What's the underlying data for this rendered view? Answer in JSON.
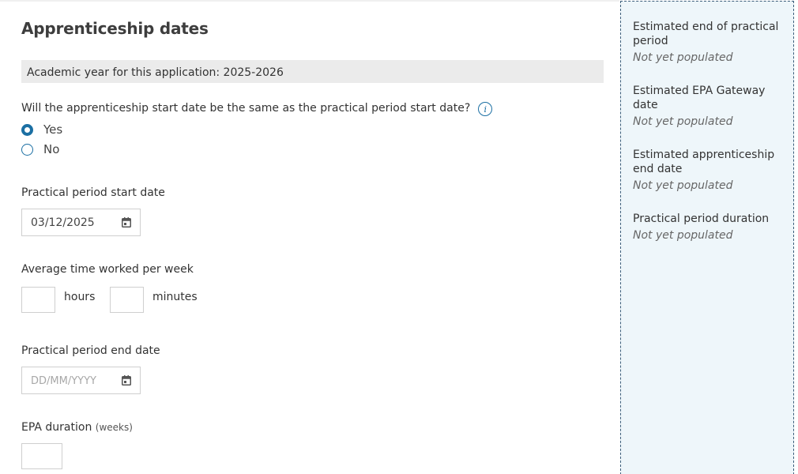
{
  "page": {
    "title": "Apprenticeship dates",
    "academic_year": "Academic year for this application: 2025-2026",
    "question": "Will the apprenticeship start date be the same as the practical period start date?",
    "radio_options": [
      {
        "label": "Yes",
        "checked": true
      },
      {
        "label": "No",
        "checked": false
      }
    ],
    "practical_start": {
      "label": "Practical period start date",
      "value": "03/12/2025"
    },
    "avg_time": {
      "label": "Average time worked per week",
      "hours_label": "hours",
      "minutes_label": "minutes",
      "hours_value": "",
      "minutes_value": ""
    },
    "practical_end": {
      "label": "Practical period end date",
      "placeholder": "DD/MM/YYYY"
    },
    "epa_duration": {
      "label": "EPA duration",
      "unit": "(weeks)",
      "value": ""
    }
  },
  "sidebar": {
    "items": [
      {
        "title": "Estimated end of practical period",
        "value": "Not yet populated"
      },
      {
        "title": "Estimated EPA Gateway date",
        "value": "Not yet populated"
      },
      {
        "title": "Estimated apprenticeship end date",
        "value": "Not yet populated"
      },
      {
        "title": "Practical period duration",
        "value": "Not yet populated"
      }
    ]
  },
  "colors": {
    "accent": "#1b6fa3",
    "sidebar_bg": "#eef6fa",
    "sidebar_border": "#3b5d7a",
    "bar_bg": "#ebebeb"
  },
  "icons": {
    "info": "info-icon",
    "calendar": "calendar-icon"
  }
}
